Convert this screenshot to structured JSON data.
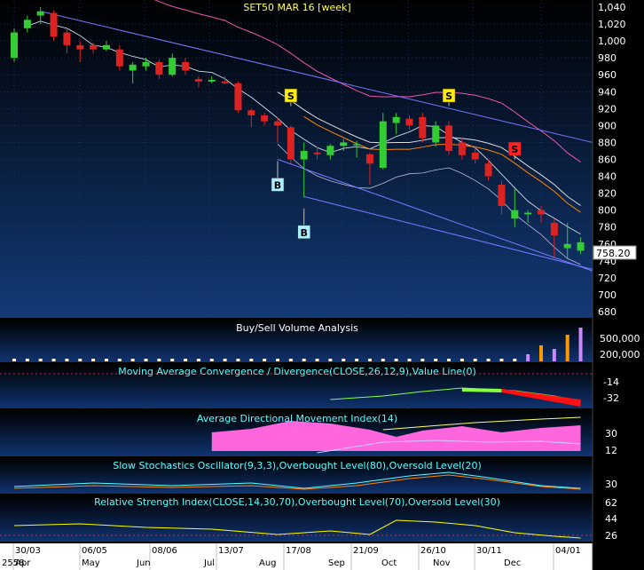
{
  "chart_data": {
    "type": "candlestick",
    "title": "SET50 MAR 16  [week]",
    "colors": {
      "background_top": "#000000",
      "background_bottom": "#123a78",
      "up": "#33cc33",
      "down": "#dd2222",
      "trend_channel": "#7777ff",
      "buy_marker": "#aaeeff",
      "sell_marker_yellow": "#ffee00",
      "sell_marker_red": "#ff2222",
      "ma_white": "#dddddd",
      "ma_orange": "#ff8800",
      "band_pink": "#ee55aa",
      "macd_line": "#88ff44",
      "macd_bar_neg": "#ff1111",
      "adx_fill": "#ff66dd",
      "stoch_k": "#55ffff",
      "stoch_d": "#ff8800",
      "rsi_line": "#ffff00"
    },
    "price_axis": {
      "min": 680,
      "max": 1040,
      "ticks": [
        1040,
        1020,
        1000,
        980,
        960,
        940,
        920,
        900,
        880,
        860,
        840,
        820,
        800,
        780,
        760,
        740,
        720,
        700,
        680
      ]
    },
    "last_price": "758.20",
    "candles": [
      {
        "o": 980,
        "h": 1015,
        "l": 975,
        "c": 1010
      },
      {
        "o": 1015,
        "h": 1030,
        "l": 1010,
        "c": 1025
      },
      {
        "o": 1030,
        "h": 1040,
        "l": 1020,
        "c": 1035
      },
      {
        "o": 1033,
        "h": 1036,
        "l": 1000,
        "c": 1005
      },
      {
        "o": 1010,
        "h": 1015,
        "l": 985,
        "c": 995
      },
      {
        "o": 995,
        "h": 1000,
        "l": 975,
        "c": 990
      },
      {
        "o": 995,
        "h": 998,
        "l": 985,
        "c": 990
      },
      {
        "o": 990,
        "h": 1000,
        "l": 988,
        "c": 995
      },
      {
        "o": 990,
        "h": 995,
        "l": 965,
        "c": 970
      },
      {
        "o": 965,
        "h": 975,
        "l": 950,
        "c": 972
      },
      {
        "o": 970,
        "h": 980,
        "l": 965,
        "c": 975
      },
      {
        "o": 975,
        "h": 978,
        "l": 955,
        "c": 960
      },
      {
        "o": 960,
        "h": 985,
        "l": 958,
        "c": 980
      },
      {
        "o": 975,
        "h": 980,
        "l": 960,
        "c": 965
      },
      {
        "o": 955,
        "h": 958,
        "l": 945,
        "c": 952
      },
      {
        "o": 952,
        "h": 958,
        "l": 950,
        "c": 954
      },
      {
        "o": 952,
        "h": 958,
        "l": 949,
        "c": 950
      },
      {
        "o": 950,
        "h": 952,
        "l": 915,
        "c": 918
      },
      {
        "o": 918,
        "h": 920,
        "l": 898,
        "c": 912
      },
      {
        "o": 912,
        "h": 915,
        "l": 900,
        "c": 905
      },
      {
        "o": 905,
        "h": 910,
        "l": 880,
        "c": 900
      },
      {
        "o": 898,
        "h": 900,
        "l": 855,
        "c": 860
      },
      {
        "o": 860,
        "h": 880,
        "l": 815,
        "c": 870
      },
      {
        "o": 868,
        "h": 875,
        "l": 860,
        "c": 866
      },
      {
        "o": 865,
        "h": 878,
        "l": 860,
        "c": 876
      },
      {
        "o": 876,
        "h": 884,
        "l": 870,
        "c": 880
      },
      {
        "o": 878,
        "h": 882,
        "l": 862,
        "c": 878
      },
      {
        "o": 866,
        "h": 868,
        "l": 830,
        "c": 855
      },
      {
        "o": 850,
        "h": 915,
        "l": 848,
        "c": 905
      },
      {
        "o": 903,
        "h": 915,
        "l": 890,
        "c": 910
      },
      {
        "o": 908,
        "h": 912,
        "l": 895,
        "c": 900
      },
      {
        "o": 910,
        "h": 915,
        "l": 880,
        "c": 885
      },
      {
        "o": 880,
        "h": 905,
        "l": 875,
        "c": 900
      },
      {
        "o": 900,
        "h": 905,
        "l": 865,
        "c": 870
      },
      {
        "o": 880,
        "h": 885,
        "l": 860,
        "c": 865
      },
      {
        "o": 868,
        "h": 875,
        "l": 855,
        "c": 860
      },
      {
        "o": 855,
        "h": 860,
        "l": 835,
        "c": 840
      },
      {
        "o": 830,
        "h": 835,
        "l": 795,
        "c": 805
      },
      {
        "o": 790,
        "h": 825,
        "l": 780,
        "c": 800
      },
      {
        "o": 795,
        "h": 800,
        "l": 785,
        "c": 797
      },
      {
        "o": 800,
        "h": 805,
        "l": 785,
        "c": 795
      },
      {
        "o": 785,
        "h": 790,
        "l": 745,
        "c": 770
      },
      {
        "o": 755,
        "h": 785,
        "l": 742,
        "c": 760
      },
      {
        "o": 752,
        "h": 768,
        "l": 748,
        "c": 762
      }
    ],
    "markers": [
      {
        "label": "S",
        "index": 21,
        "price": 935,
        "color": "yellow"
      },
      {
        "label": "B",
        "index": 20,
        "price": 838,
        "color": "cyan",
        "below": true
      },
      {
        "label": "B",
        "index": 22,
        "price": 782,
        "color": "cyan",
        "below": true
      },
      {
        "label": "S",
        "index": 33,
        "price": 935,
        "color": "yellow"
      },
      {
        "label": "S",
        "index": 38,
        "price": 872,
        "color": "red"
      }
    ],
    "date_ticks": [
      "30/03",
      "06/05",
      "08/06",
      "13/07",
      "17/08",
      "21/09",
      "26/10",
      "30/11",
      "04/01"
    ],
    "month_labels": [
      "Apr",
      "May",
      "Jun",
      "Jul",
      "Aug",
      "Sep",
      "Oct",
      "Nov",
      "Dec"
    ],
    "year_label": "2558",
    "panels": [
      {
        "name": "volume",
        "title": "Buy/Sell Volume Analysis",
        "ticks": [
          "500,000",
          "200,000"
        ]
      },
      {
        "name": "macd",
        "title": "Moving Average Convergence / Divergence(CLOSE,26,12,9),Value Line(0)",
        "ticks": [
          "-14",
          "-32"
        ]
      },
      {
        "name": "adx",
        "title": "Average Directional Movement Index(14)",
        "ticks": [
          "30",
          "12"
        ]
      },
      {
        "name": "stoch",
        "title": "Slow Stochastics Oscillator(9,3,3),Overbought Level(80),Oversold Level(20)",
        "ticks": [
          "30"
        ]
      },
      {
        "name": "rsi",
        "title": "Relative Strength Index(CLOSE,14,30,70),Overbought Level(70),Oversold Level(30)",
        "ticks": [
          "62",
          "44",
          "26"
        ]
      }
    ]
  }
}
